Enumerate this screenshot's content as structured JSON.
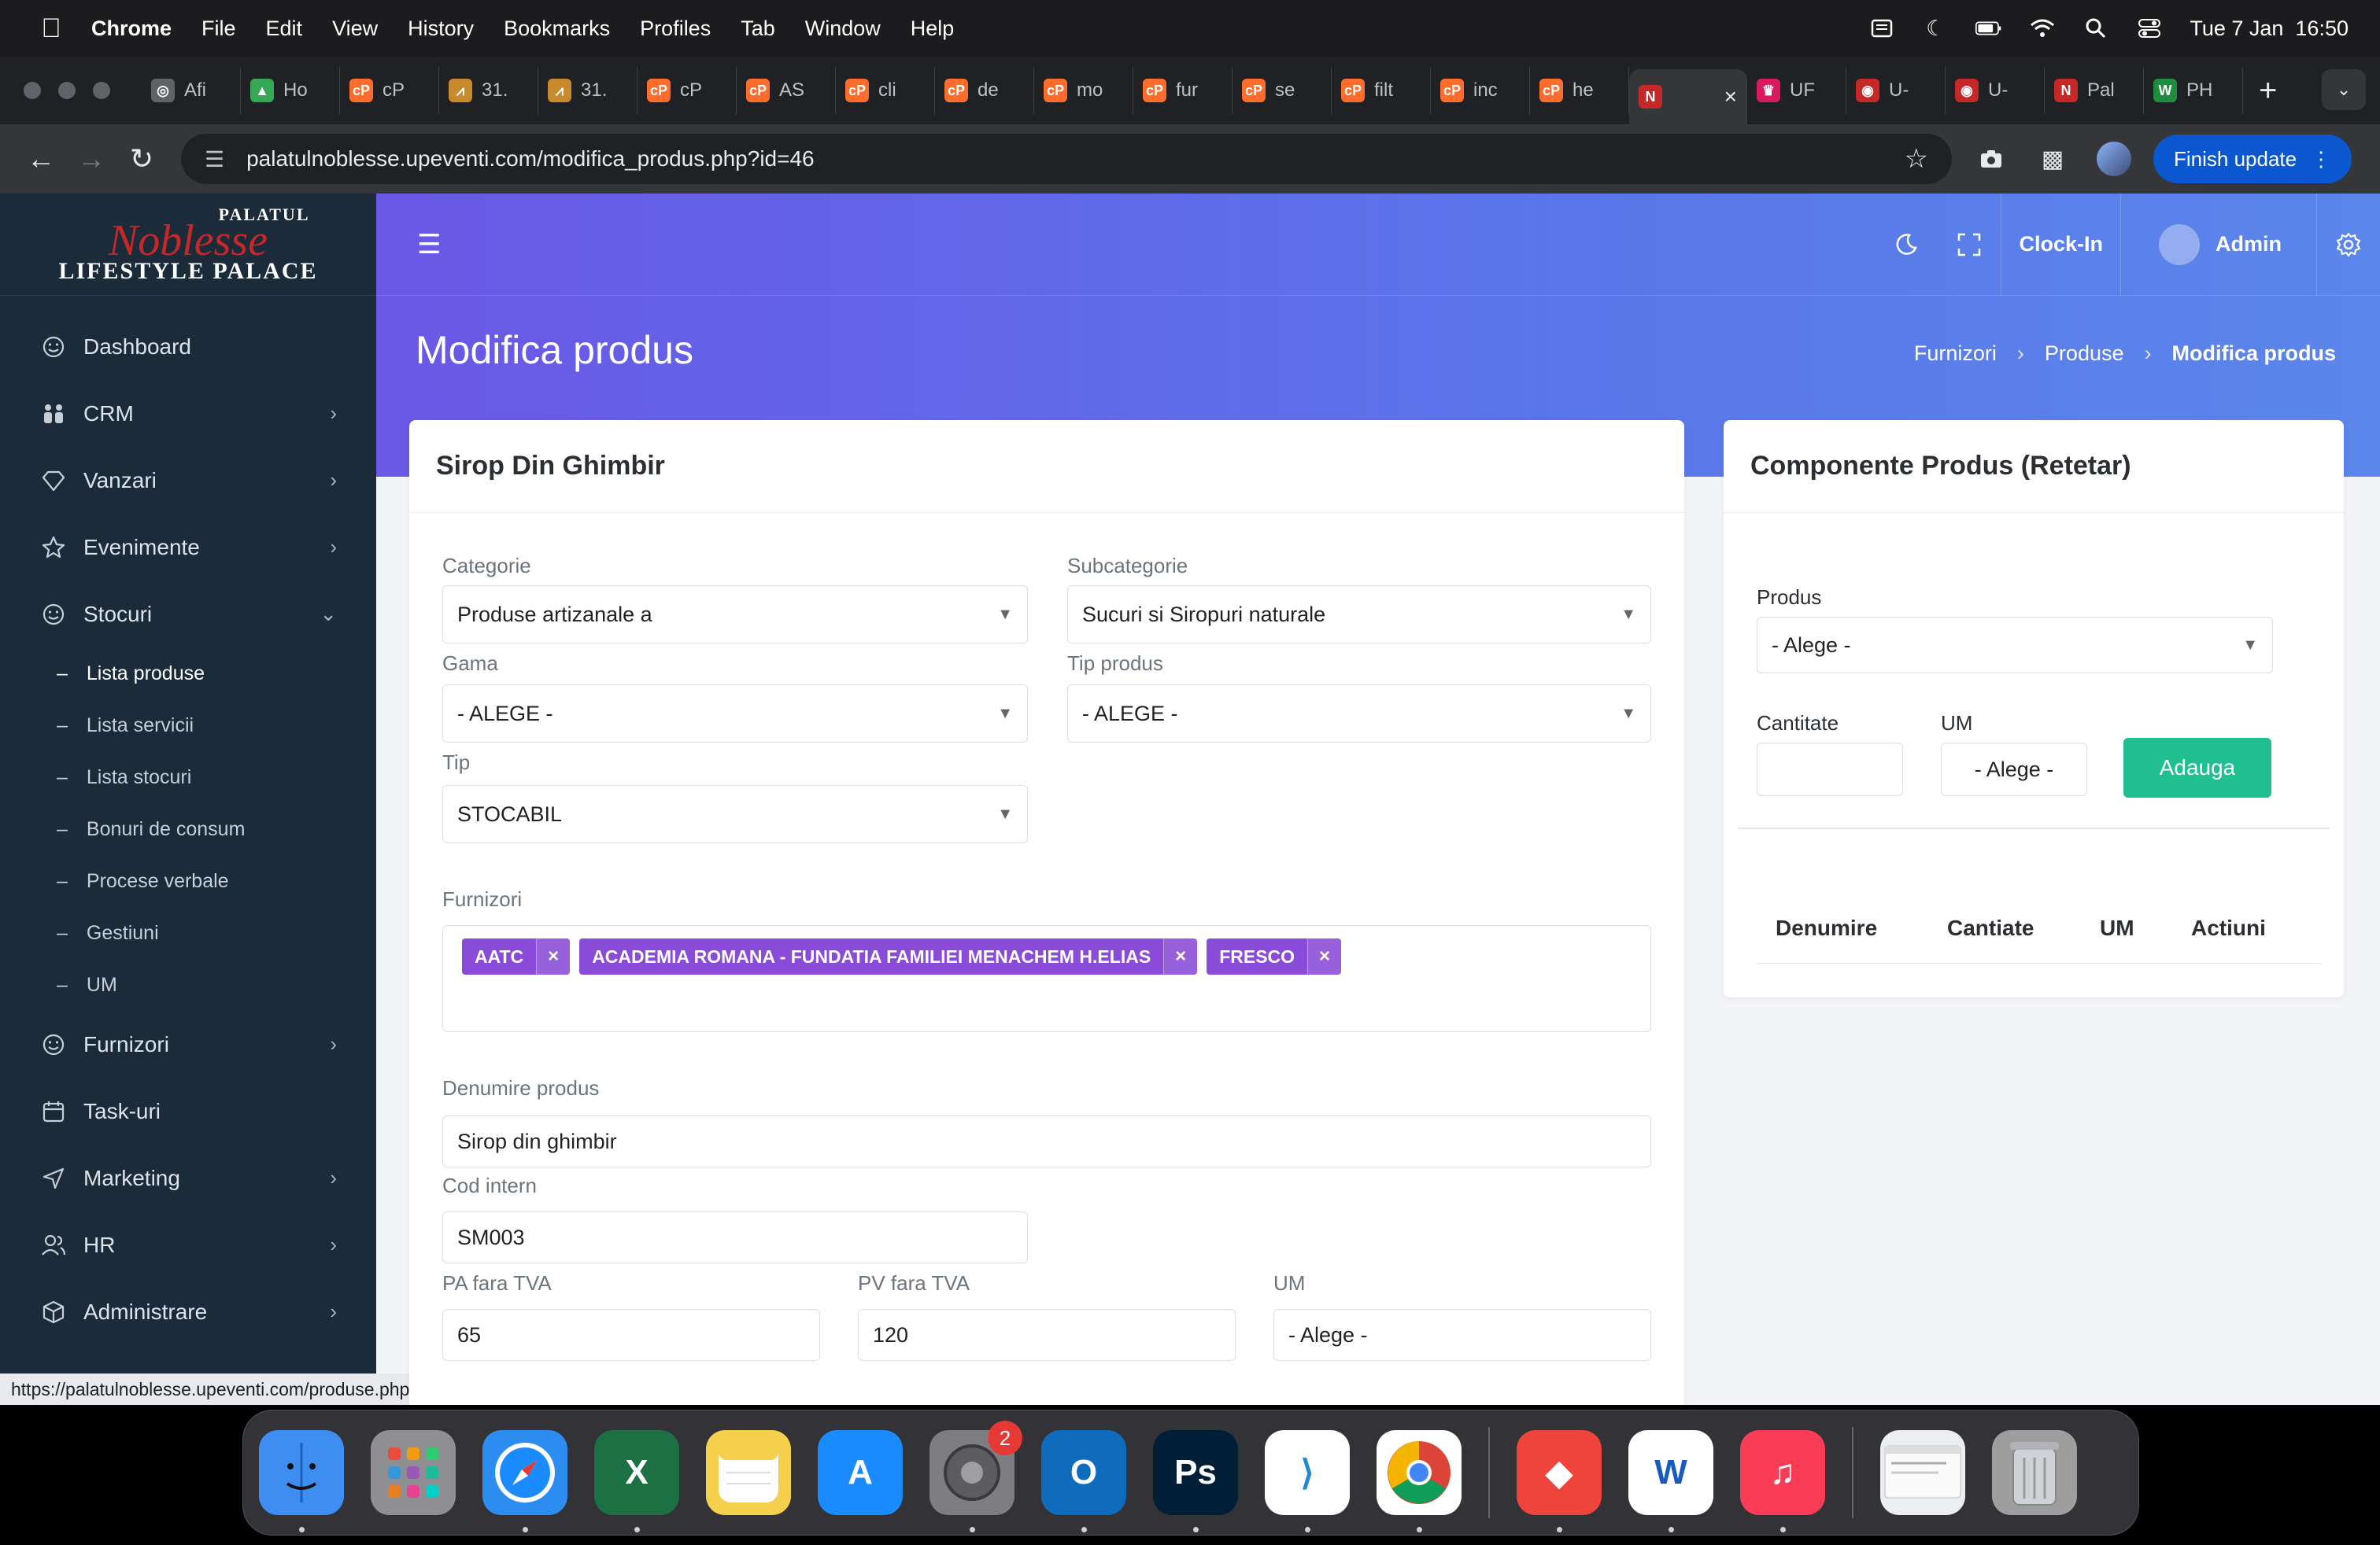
{
  "menubar": {
    "app": "Chrome",
    "items": [
      "File",
      "Edit",
      "View",
      "History",
      "Bookmarks",
      "Profiles",
      "Tab",
      "Window",
      "Help"
    ],
    "datetime": "Tue 7 Jan  16:50"
  },
  "tabs": [
    {
      "label": "Afi",
      "color": "#5f6368",
      "glyph": "◎"
    },
    {
      "label": "Ho",
      "color": "#34a853",
      "glyph": "▲"
    },
    {
      "label": "cP",
      "color": "#ff6c2c",
      "glyph": "cP"
    },
    {
      "label": "31.",
      "color": "#c78a2c",
      "glyph": "⩘"
    },
    {
      "label": "31.",
      "color": "#c78a2c",
      "glyph": "⩘"
    },
    {
      "label": "cP",
      "color": "#ff6c2c",
      "glyph": "cP"
    },
    {
      "label": "AS",
      "color": "#ff6c2c",
      "glyph": "cP"
    },
    {
      "label": "cli",
      "color": "#ff6c2c",
      "glyph": "cP"
    },
    {
      "label": "de",
      "color": "#ff6c2c",
      "glyph": "cP"
    },
    {
      "label": "mo",
      "color": "#ff6c2c",
      "glyph": "cP"
    },
    {
      "label": "fur",
      "color": "#ff6c2c",
      "glyph": "cP"
    },
    {
      "label": "se",
      "color": "#ff6c2c",
      "glyph": "cP"
    },
    {
      "label": "filt",
      "color": "#ff6c2c",
      "glyph": "cP"
    },
    {
      "label": "inc",
      "color": "#ff6c2c",
      "glyph": "cP"
    },
    {
      "label": "he",
      "color": "#ff6c2c",
      "glyph": "cP"
    },
    {
      "label": "",
      "color": "#c62828",
      "glyph": "N",
      "active": true
    },
    {
      "label": "UF",
      "color": "#d81b60",
      "glyph": "♛"
    },
    {
      "label": "U-",
      "color": "#c62828",
      "glyph": "◉"
    },
    {
      "label": "U-",
      "color": "#c62828",
      "glyph": "◉"
    },
    {
      "label": "Pal",
      "color": "#c62828",
      "glyph": "N"
    },
    {
      "label": "PH",
      "color": "#1e8e3e",
      "glyph": "W"
    }
  ],
  "browser": {
    "url": "palatulnoblesse.upeventi.com/modifica_produs.php?id=46",
    "finish_update": "Finish update"
  },
  "brand": {
    "line1": "PALATUL",
    "line2": "Noblesse",
    "line3": "LIFESTYLE PALACE"
  },
  "sidebar": {
    "items": [
      {
        "label": "Dashboard",
        "icon": "smile-icon",
        "chevron": ""
      },
      {
        "label": "CRM",
        "icon": "people-icon",
        "chevron": "›"
      },
      {
        "label": "Vanzari",
        "icon": "diamond-icon",
        "chevron": "›"
      },
      {
        "label": "Evenimente",
        "icon": "star-icon",
        "chevron": "›"
      },
      {
        "label": "Stocuri",
        "icon": "smile-icon",
        "chevron": "⌄"
      }
    ],
    "stocuri_sub": [
      "Lista produse",
      "Lista servicii",
      "Lista stocuri",
      "Bonuri de consum",
      "Procese verbale",
      "Gestiuni",
      "UM"
    ],
    "items_after": [
      {
        "label": "Furnizori",
        "icon": "smile-icon",
        "chevron": "›"
      },
      {
        "label": "Task-uri",
        "icon": "calendar-icon",
        "chevron": ""
      },
      {
        "label": "Marketing",
        "icon": "send-icon",
        "chevron": "›"
      },
      {
        "label": "HR",
        "icon": "users-icon",
        "chevron": "›"
      },
      {
        "label": "Administrare",
        "icon": "box-icon",
        "chevron": "›"
      }
    ]
  },
  "status_url": "https://palatulnoblesse.upeventi.com/produse.php",
  "topbar": {
    "clock_in": "Clock-In",
    "admin": "Admin"
  },
  "page": {
    "title": "Modifica produs",
    "breadcrumb": [
      "Furnizori",
      "Produse",
      "Modifica produs"
    ]
  },
  "form": {
    "card_title": "Sirop Din Ghimbir",
    "categorie_label": "Categorie",
    "categorie_value": "Produse artizanale a",
    "subcategorie_label": "Subcategorie",
    "subcategorie_value": "Sucuri si Siropuri naturale",
    "gama_label": "Gama",
    "gama_value": "- ALEGE -",
    "tip_produs_label": "Tip produs",
    "tip_produs_value": "- ALEGE -",
    "tip_label": "Tip",
    "tip_value": "STOCABIL",
    "furnizori_label": "Furnizori",
    "furnizori": [
      "AATC",
      "ACADEMIA ROMANA - FUNDATIA FAMILIEI MENACHEM H.ELIAS",
      "FRESCO"
    ],
    "denumire_label": "Denumire produs",
    "denumire_value": "Sirop din ghimbir",
    "cod_label": "Cod intern",
    "cod_value": "SM003",
    "pa_label": "PA fara TVA",
    "pa_value": "65",
    "pv_label": "PV fara TVA",
    "pv_value": "120",
    "um_label": "UM",
    "um_value": "- Alege -"
  },
  "recipe": {
    "card_title": "Componente Produs (Retetar)",
    "produs_label": "Produs",
    "produs_value": "- Alege -",
    "cantitate_label": "Cantitate",
    "cantitate_value": "",
    "um_label": "UM",
    "um_value": "- Alege -",
    "add_button": "Adauga",
    "columns": [
      "Denumire",
      "Cantiate",
      "UM",
      "Actiuni"
    ]
  },
  "dock": [
    {
      "name": "finder",
      "color": "#3d8ef0"
    },
    {
      "name": "launchpad",
      "color": "#8e8e93"
    },
    {
      "name": "safari",
      "color": "#2d8cf0"
    },
    {
      "name": "excel",
      "color": "#1d7044",
      "glyph": "X"
    },
    {
      "name": "notes",
      "color": "#f5d04c"
    },
    {
      "name": "app-store",
      "color": "#1a8cff",
      "glyph": "A"
    },
    {
      "name": "system-settings",
      "color": "#7d7d82",
      "badge": "2"
    },
    {
      "name": "outlook",
      "color": "#0f6cbd",
      "glyph": "O"
    },
    {
      "name": "photoshop",
      "color": "#001e36",
      "glyph": "Ps"
    },
    {
      "name": "vscode",
      "color": "#ffffff",
      "glyph": "⟩"
    },
    {
      "name": "chrome",
      "color": "#ffffff"
    },
    {
      "name": "anydesk",
      "color": "#ef443b",
      "glyph": "◆"
    },
    {
      "name": "word",
      "color": "#ffffff",
      "glyph": "W"
    },
    {
      "name": "music",
      "color": "#fa3c56",
      "glyph": "♫"
    },
    {
      "name": "preview-window",
      "color": "#eceff1"
    },
    {
      "name": "trash",
      "color": "#9e9e9e"
    }
  ]
}
